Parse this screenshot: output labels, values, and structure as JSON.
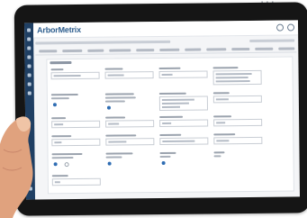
{
  "app": {
    "logo_text": "ArborMetrix",
    "brand_color": "#2f5f8f",
    "rail_color": "#1f3f63",
    "accent_color": "#2f6db3"
  },
  "icons": {
    "rail": [
      "home-icon",
      "grid-icon",
      "chart-icon",
      "user-icon",
      "list-icon",
      "settings-icon",
      "help-icon",
      "info-icon",
      "menu-icon"
    ],
    "topbar": [
      "user-icon",
      "help-icon"
    ]
  }
}
